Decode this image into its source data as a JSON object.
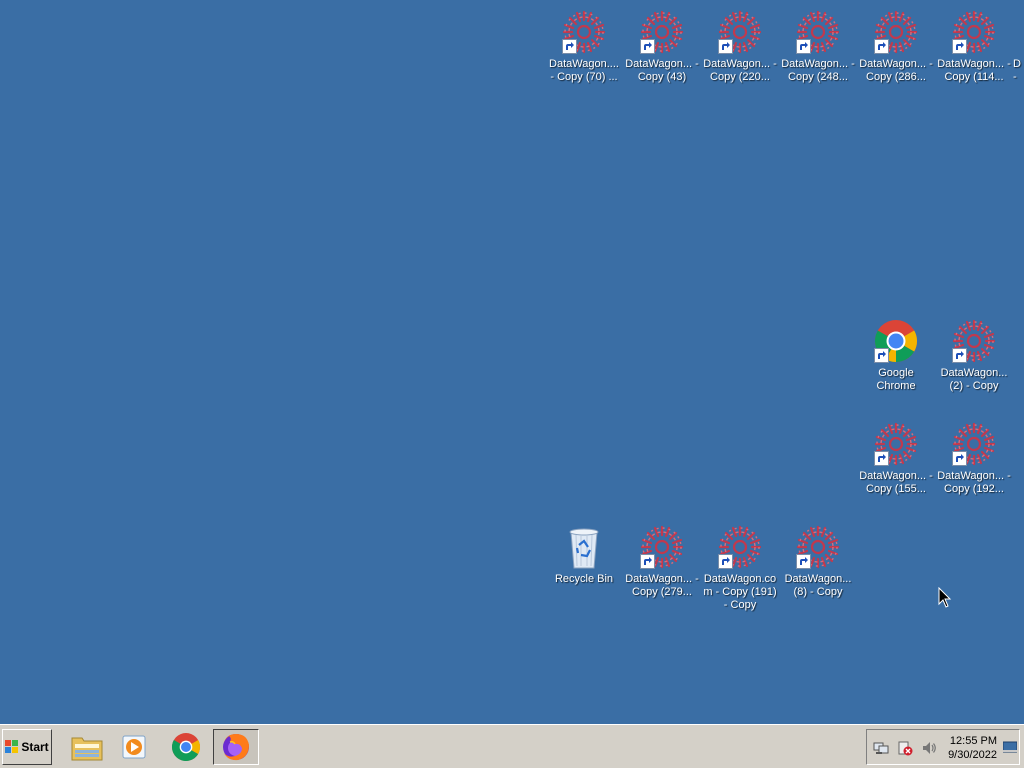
{
  "desktop": {
    "background": "#3a6ea5",
    "icons": [
      {
        "label": "DataWagon.... - Copy (70) ...",
        "type": "datawagon-shortcut"
      },
      {
        "label": "DataWagon... - Copy (43)",
        "type": "datawagon-shortcut"
      },
      {
        "label": "DataWagon... - Copy (220...",
        "type": "datawagon-shortcut"
      },
      {
        "label": "DataWagon... - Copy (248...",
        "type": "datawagon-shortcut"
      },
      {
        "label": "DataWagon... - Copy (286...",
        "type": "datawagon-shortcut"
      },
      {
        "label": "DataWagon... - Copy (114...",
        "type": "datawagon-shortcut"
      },
      {
        "label": "Google Chrome",
        "type": "chrome-shortcut"
      },
      {
        "label": "DataWagon... (2) - Copy",
        "type": "datawagon-shortcut"
      },
      {
        "label": "DataWagon... - Copy (155...",
        "type": "datawagon-shortcut"
      },
      {
        "label": "DataWagon... - Copy (192...",
        "type": "datawagon-shortcut"
      },
      {
        "label": "Recycle Bin",
        "type": "recycle-bin"
      },
      {
        "label": "DataWagon... - Copy (279...",
        "type": "datawagon-shortcut"
      },
      {
        "label": "DataWagon.co m - Copy (191) - Copy",
        "type": "datawagon-shortcut"
      },
      {
        "label": "DataWagon... (8) - Copy",
        "type": "datawagon-shortcut"
      }
    ],
    "partial_edge_label": "D -"
  },
  "taskbar": {
    "start_label": "Start",
    "pinned": [
      "file-explorer-icon",
      "media-player-icon",
      "chrome-icon",
      "firefox-icon"
    ],
    "active": "firefox-icon",
    "tray_icons": [
      "network-icon",
      "action-center-icon",
      "speaker-icon"
    ],
    "clock_time": "12:55 PM",
    "clock_date": "9/30/2022"
  }
}
